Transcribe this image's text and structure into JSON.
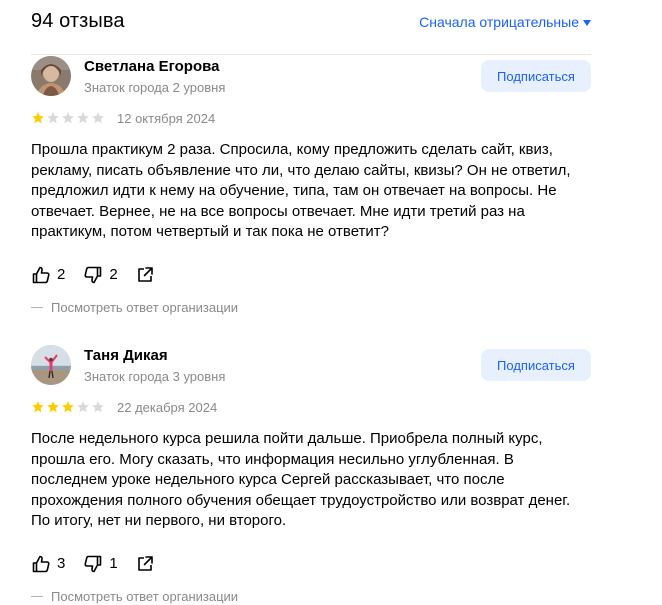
{
  "header": {
    "reviews_count": "94 отзыва",
    "sort_label": "Сначала отрицательные"
  },
  "reviews": [
    {
      "author": "Светлана Егорова",
      "level": "Знаток города 2 уровня",
      "subscribe_label": "Подписаться",
      "rating": 1,
      "date": "12 октября 2024",
      "text": "Прошла практикум 2 раза. Спросила, кому предложить сделать сайт, квиз, рекламу, писать объявление что ли, что делаю сайты, квизы? Он не ответил, предложил идти к нему на обучение, типа, там он отвечает на вопросы. Не отвечает. Вернее, не на все вопросы отвечает. Мне идти третий раз на практикум, потом четвертый и так пока не ответит?",
      "likes": "2",
      "dislikes": "2",
      "org_answer_label": "Посмотреть ответ организации"
    },
    {
      "author": "Таня Дикая",
      "level": "Знаток города 3 уровня",
      "subscribe_label": "Подписаться",
      "rating": 3,
      "date": "22 декабря 2024",
      "text": "После недельного курса решила пойти дальше. Приобрела полный курс, прошла его. Могу сказать, что информация несильно углубленная. В последнем уроке недельного курса Сергей рассказывает, что после прохождения полного обучения обещает трудоустройство или возврат денег. По итогу, нет ни первого, ни второго.",
      "likes": "3",
      "dislikes": "1",
      "org_answer_label": "Посмотреть ответ организации"
    }
  ],
  "colors": {
    "accent": "#1a61ff",
    "star_filled": "#fc0",
    "star_empty": "#d9d9d9",
    "muted": "#8a8a8a",
    "button_bg": "#e8f0fe"
  },
  "icons": {
    "like": "thumb-up-icon",
    "dislike": "thumb-down-icon",
    "share": "share-icon",
    "sort": "caret-down-icon"
  }
}
